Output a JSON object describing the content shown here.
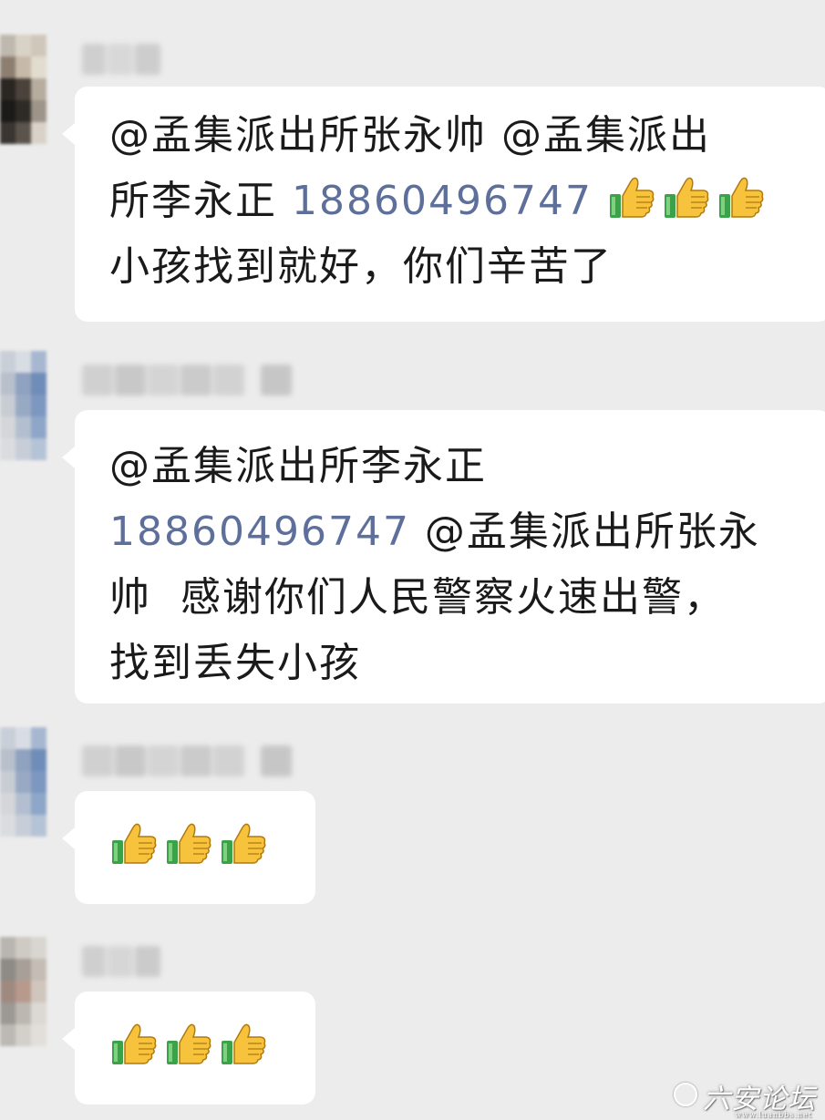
{
  "messages": [
    {
      "lines": [
        {
          "parts": [
            {
              "t": "@孟集派出所张永帅 @孟集派出"
            }
          ]
        },
        {
          "parts": [
            {
              "t": "所李永正 "
            },
            {
              "phone": "18860496747"
            },
            {
              "t": " "
            },
            {
              "thumbs": 3
            }
          ]
        },
        {
          "parts": [
            {
              "t": "小孩找到就好，你们辛苦了"
            }
          ]
        }
      ]
    },
    {
      "lines": [
        {
          "parts": [
            {
              "t": " @孟集派出所李永正"
            }
          ]
        },
        {
          "parts": [
            {
              "phone": "18860496747"
            },
            {
              "t": " @孟集派出所张永"
            }
          ]
        },
        {
          "parts": [
            {
              "t": "帅  感谢你们人民警察火速出警，"
            }
          ]
        },
        {
          "parts": [
            {
              "t": "找到丢失小孩"
            }
          ]
        }
      ]
    },
    {
      "lines": [
        {
          "parts": [
            {
              "thumbs": 3
            }
          ]
        }
      ]
    },
    {
      "lines": [
        {
          "parts": [
            {
              "thumbs": 3
            }
          ]
        }
      ]
    }
  ],
  "icons": {
    "reaction": "thumbs-up-icon"
  },
  "colors": {
    "background": "#ececec",
    "bubble": "#ffffff",
    "phone_link": "#5d6f9a",
    "text": "#1a1a1a"
  },
  "watermark": {
    "text": "六安论坛",
    "sub": "www.luanbbs.net"
  }
}
